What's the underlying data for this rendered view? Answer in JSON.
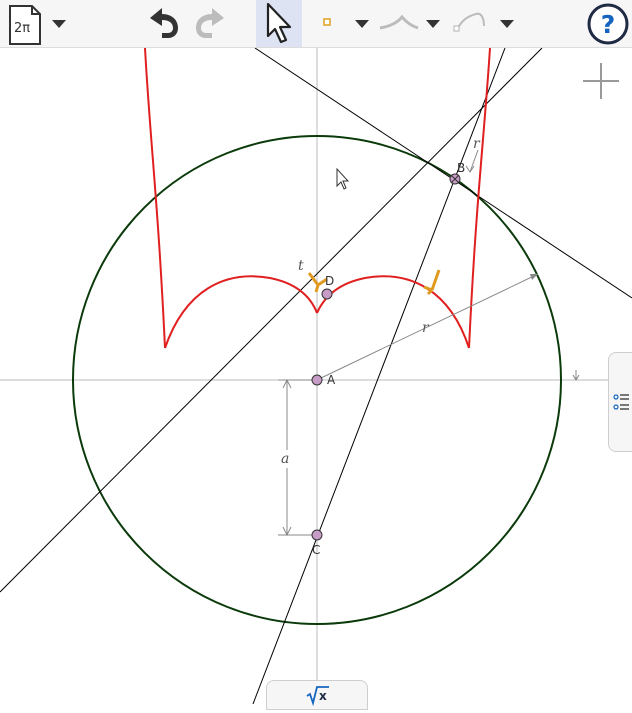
{
  "toolbar": {
    "app_icon_label": "2π",
    "tools": [
      {
        "name": "menu",
        "icon": "file-menu-icon"
      },
      {
        "name": "undo",
        "icon": "undo-icon"
      },
      {
        "name": "redo",
        "icon": "redo-icon"
      },
      {
        "name": "move",
        "icon": "move-arrow-icon",
        "selected": true
      },
      {
        "name": "point",
        "icon": "point-icon"
      },
      {
        "name": "line",
        "icon": "line-tool-icon"
      },
      {
        "name": "curve",
        "icon": "curve-tool-icon"
      },
      {
        "name": "help",
        "icon": "help-icon"
      }
    ]
  },
  "canvas": {
    "points": {
      "A": "A",
      "B": "B",
      "C": "C",
      "D": "D"
    },
    "labels": {
      "r": "r",
      "a": "a",
      "t": "t"
    },
    "colors": {
      "circle": "#0b3a0b",
      "curve": "#e02020",
      "point_fill": "#c79cc6",
      "marker": "#e09a20",
      "line": "#000000",
      "axis": "#bbbbbb",
      "help": "#1565c0"
    }
  },
  "side_panel": {
    "icon": "algebra-list-icon"
  },
  "input_bar": {
    "icon": "sqrt-x-icon",
    "label": "√x"
  }
}
